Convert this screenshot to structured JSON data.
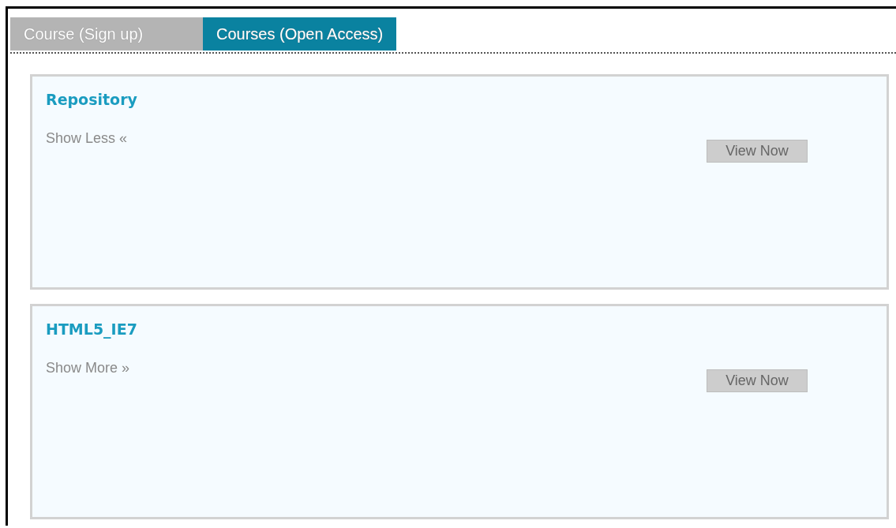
{
  "tabs": [
    {
      "label": "Course (Sign up)",
      "selected": false
    },
    {
      "label": "Courses (Open Access)",
      "selected": true
    }
  ],
  "courses": [
    {
      "title": "Repository",
      "toggle": "Show Less «",
      "button": "View Now"
    },
    {
      "title": "HTML5_IE7",
      "toggle": "Show More »",
      "button": "View Now"
    }
  ]
}
